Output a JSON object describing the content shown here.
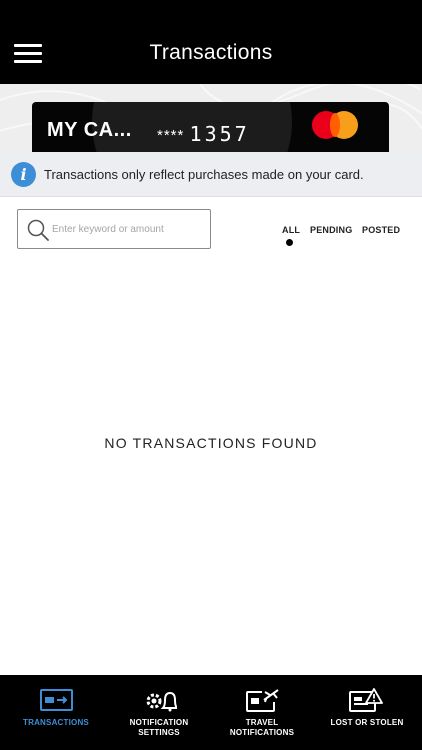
{
  "header": {
    "title": "Transactions",
    "menu_icon": "hamburger-menu-icon"
  },
  "card": {
    "name": "MY CA...",
    "mask": "****",
    "last_four": "1357",
    "brand_icon": "mastercard-logo"
  },
  "info": {
    "icon": "info-icon",
    "text": "Transactions only reflect purchases made on your card.",
    "accent_color": "#3c8fd6"
  },
  "search": {
    "placeholder": "Enter keyword or amount",
    "value": ""
  },
  "filters": {
    "items": [
      "ALL",
      "PENDING",
      "POSTED"
    ],
    "selected": "ALL"
  },
  "empty_state": {
    "message": "NO TRANSACTIONS FOUND"
  },
  "bottom_nav": {
    "items": [
      {
        "label": "TRANSACTIONS",
        "icon": "card-transfer-icon",
        "active": true
      },
      {
        "label_line1": "NOTIFICATION",
        "label_line2": "SETTINGS",
        "icon": "gear-bell-icon",
        "active": false
      },
      {
        "label_line1": "TRAVEL",
        "label_line2": "NOTIFICATIONS",
        "icon": "card-airplane-icon",
        "active": false
      },
      {
        "label": "LOST OR STOLEN",
        "icon": "card-warning-icon",
        "active": false
      }
    ],
    "active_color": "#3c8fd6"
  }
}
